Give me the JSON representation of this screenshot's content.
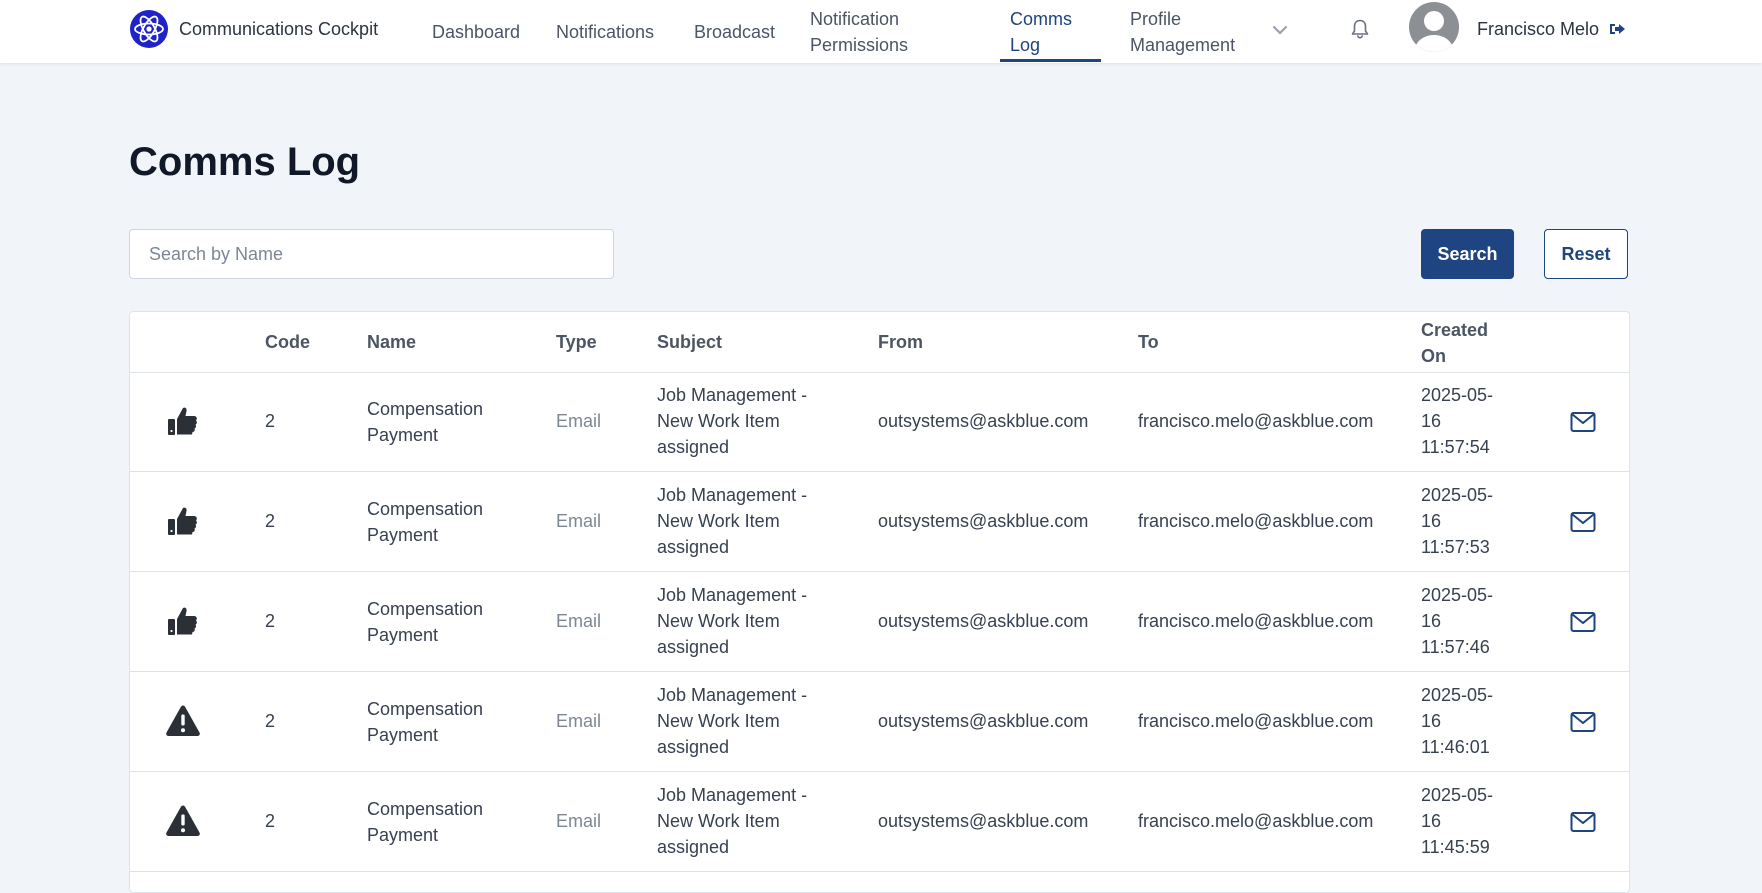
{
  "app": {
    "title": "Communications Cockpit"
  },
  "nav": {
    "dashboard": "Dashboard",
    "notifications": "Notifications",
    "broadcast": "Broadcast",
    "notification_permissions_1": "Notification",
    "notification_permissions_2": "Permissions",
    "comms_log_1": "Comms",
    "comms_log_2": "Log",
    "profile_management_1": "Profile",
    "profile_management_2": "Management"
  },
  "user": {
    "name": "Francisco Melo"
  },
  "page": {
    "title": "Comms Log"
  },
  "search": {
    "placeholder": "Search by Name",
    "value": ""
  },
  "buttons": {
    "search": "Search",
    "reset": "Reset"
  },
  "colors": {
    "accent": "#1e4482",
    "background": "#f1f4f8"
  },
  "table": {
    "headers": {
      "code": "Code",
      "name": "Name",
      "type": "Type",
      "subject": "Subject",
      "from": "From",
      "to": "To",
      "created_1": "Created",
      "created_2": "On"
    },
    "rows": [
      {
        "status": "thumbs-up-icon",
        "code": "2",
        "name_1": "Compensation",
        "name_2": "Payment",
        "type": "Email",
        "subject_1": "Job Management -",
        "subject_2": "New Work Item",
        "subject_3": "assigned",
        "from": "outsystems@askblue.com",
        "to": "francisco.melo@askblue.com",
        "created_1": "2025-05-",
        "created_2": "16",
        "created_3": "11:57:54"
      },
      {
        "status": "thumbs-up-icon",
        "code": "2",
        "name_1": "Compensation",
        "name_2": "Payment",
        "type": "Email",
        "subject_1": "Job Management -",
        "subject_2": "New Work Item",
        "subject_3": "assigned",
        "from": "outsystems@askblue.com",
        "to": "francisco.melo@askblue.com",
        "created_1": "2025-05-",
        "created_2": "16",
        "created_3": "11:57:53"
      },
      {
        "status": "thumbs-up-icon",
        "code": "2",
        "name_1": "Compensation",
        "name_2": "Payment",
        "type": "Email",
        "subject_1": "Job Management -",
        "subject_2": "New Work Item",
        "subject_3": "assigned",
        "from": "outsystems@askblue.com",
        "to": "francisco.melo@askblue.com",
        "created_1": "2025-05-",
        "created_2": "16",
        "created_3": "11:57:46"
      },
      {
        "status": "warning-icon",
        "code": "2",
        "name_1": "Compensation",
        "name_2": "Payment",
        "type": "Email",
        "subject_1": "Job Management -",
        "subject_2": "New Work Item",
        "subject_3": "assigned",
        "from": "outsystems@askblue.com",
        "to": "francisco.melo@askblue.com",
        "created_1": "2025-05-",
        "created_2": "16",
        "created_3": "11:46:01"
      },
      {
        "status": "warning-icon",
        "code": "2",
        "name_1": "Compensation",
        "name_2": "Payment",
        "type": "Email",
        "subject_1": "Job Management -",
        "subject_2": "New Work Item",
        "subject_3": "assigned",
        "from": "outsystems@askblue.com",
        "to": "francisco.melo@askblue.com",
        "created_1": "2025-05-",
        "created_2": "16",
        "created_3": "11:45:59"
      }
    ]
  }
}
